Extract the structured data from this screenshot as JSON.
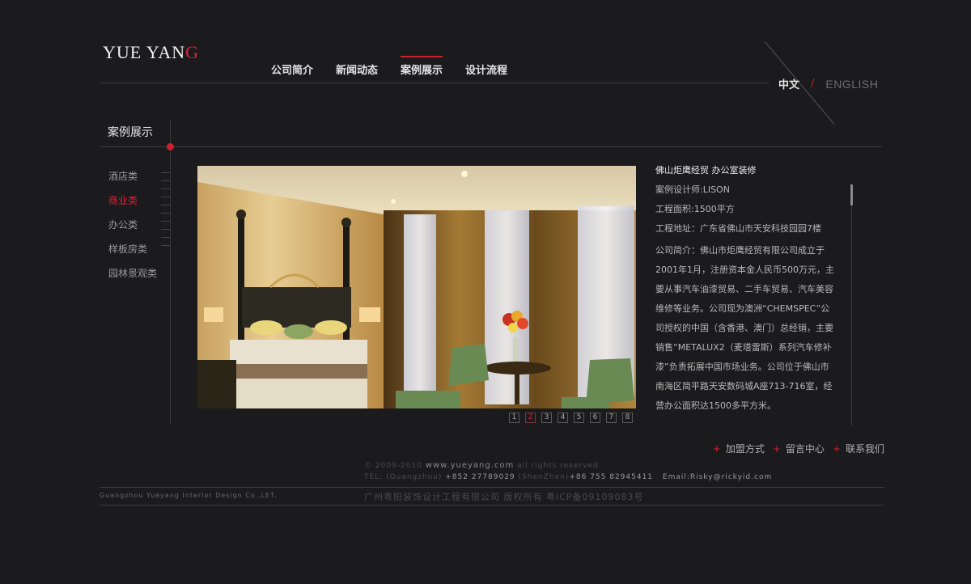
{
  "logo": {
    "text_main": "YUE YAN",
    "text_accent": "G"
  },
  "nav": [
    "公司简介",
    "新闻动态",
    "案例展示",
    "设计流程"
  ],
  "nav_active": 2,
  "lang": {
    "cn": "中文",
    "sep": "/",
    "en": "ENGLISH"
  },
  "section_title": "案例展示",
  "categories": [
    "酒店类",
    "商业类",
    "办公类",
    "样板房类",
    "园林景观类"
  ],
  "category_active": 1,
  "pagination": [
    "1",
    "2",
    "3",
    "4",
    "5",
    "6",
    "7",
    "8"
  ],
  "pagination_active": 1,
  "info": {
    "title": "佛山炬鹰经贸 办公室装修",
    "designer": "案例设计师:LISON",
    "area": "工程面积:1500平方",
    "address": "工程地址：广东省佛山市天安科技园园7楼",
    "intro": "公司简介：佛山市炬鹰经贸有限公司成立于2001年1月，注册资本金人民币500万元，主要从事汽车油漆贸易、二手车贸易、汽车美容维修等业务。公司现为澳洲“CHEMSPEC”公司授权的中国（含香港、澳门）总经销，主要销售“METALUX2（麦塔雷斯）系列汽车修补漆”负责拓展中国市场业务。公司位于佛山市南海区简平路天安数码城A座713-716室，经营办公面积达1500多平方米。"
  },
  "footer": {
    "links": [
      "加盟方式",
      "留言中心",
      "联系我们"
    ],
    "copyright_year": "© 2009-2010",
    "site": "www.yueyang.com",
    "rights": "all rights reserved.",
    "tel_label": "TEL:",
    "gz_label": "(Guangzhou)",
    "gz_phone": "+852 27789029",
    "sz_label": "(ShenZhen)",
    "sz_phone": "+86 755 82945411",
    "email": "Email:Risky@rickyid.com",
    "company_en": "Guangzhou Yueyang Interior Design Co.,LET.",
    "company_cn": "广州粤阳装饰设计工程有限公司 版权所有 粤ICP备09109083号"
  },
  "colors": {
    "accent": "#e0213a",
    "background": "#1b1a1c"
  }
}
